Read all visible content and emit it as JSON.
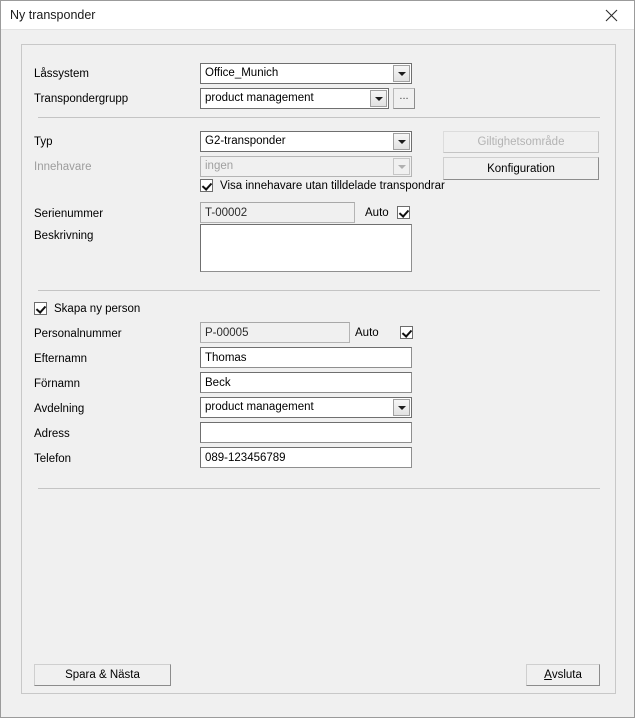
{
  "window": {
    "title": "Ny transponder",
    "close_icon": "close-icon"
  },
  "section_system": {
    "locking_system": {
      "label": "Låssystem",
      "value": "Office_Munich"
    },
    "transponder_group": {
      "label": "Transpondergrupp",
      "value": "product management",
      "browse_label": "..."
    }
  },
  "section_transponder": {
    "type": {
      "label": "Typ",
      "value": "G2-transponder"
    },
    "owner": {
      "label": "Innehavare",
      "value": "ingen"
    },
    "show_owners_checkbox": {
      "label": "Visa innehavare utan tilldelade transpondrar",
      "checked": true
    },
    "serial_number": {
      "label": "Serienummer",
      "value": "T-00002",
      "auto_label": "Auto",
      "auto_checked": true
    },
    "description": {
      "label": "Beskrivning",
      "value": ""
    },
    "validity_button": "Giltighetsområde",
    "configuration_button": "Konfiguration"
  },
  "section_person": {
    "create_new_person": {
      "label": "Skapa ny person",
      "checked": true
    },
    "personnel_number": {
      "label": "Personalnummer",
      "value": "P-00005",
      "auto_label": "Auto",
      "auto_checked": true
    },
    "last_name": {
      "label": "Efternamn",
      "value": "Thomas"
    },
    "first_name": {
      "label": "Förnamn",
      "value": "Beck"
    },
    "department": {
      "label": "Avdelning",
      "value": "product management"
    },
    "address": {
      "label": "Adress",
      "value": ""
    },
    "phone": {
      "label": "Telefon",
      "value": "089-123456789"
    }
  },
  "footer": {
    "save_next_button": "Spara & Nästa",
    "exit_button_accel": "A",
    "exit_button_rest": "vsluta"
  }
}
